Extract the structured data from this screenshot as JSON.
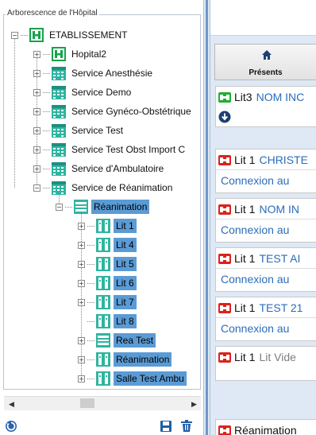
{
  "tree_panel": {
    "legend": "Arborescence de l'Hôpital",
    "nodes": [
      {
        "label": "ETABLISSEMENT",
        "icon": "hospital-icon",
        "level": 0,
        "expander": "−"
      },
      {
        "label": "Hopital2",
        "icon": "hospital-icon",
        "level": 1,
        "expander": "+"
      },
      {
        "label": "Service Anesthésie",
        "icon": "service-icon",
        "level": 1,
        "expander": "+"
      },
      {
        "label": "Service Demo",
        "icon": "service-icon",
        "level": 1,
        "expander": "+"
      },
      {
        "label": "Service Gynéco-Obstétrique",
        "icon": "service-icon",
        "level": 1,
        "expander": "+"
      },
      {
        "label": "Service Test",
        "icon": "service-icon",
        "level": 1,
        "expander": "+"
      },
      {
        "label": "Service Test Obst Import C",
        "icon": "service-icon",
        "level": 1,
        "expander": "+"
      },
      {
        "label": "Service d'Ambulatoire",
        "icon": "service-icon",
        "level": 1,
        "expander": "+"
      },
      {
        "label": "Service de Réanimation",
        "icon": "service-icon",
        "level": 1,
        "expander": "−"
      },
      {
        "label": "Réanimation",
        "icon": "unit-icon",
        "level": 2,
        "expander": "−",
        "selected": true
      },
      {
        "label": "Lit 1",
        "icon": "bed-icon",
        "level": 3,
        "expander": "+",
        "selected": true
      },
      {
        "label": "Lit 4",
        "icon": "bed-icon",
        "level": 3,
        "expander": "+",
        "selected": true
      },
      {
        "label": "Lit 5",
        "icon": "bed-icon",
        "level": 3,
        "expander": "+",
        "selected": true
      },
      {
        "label": "Lit 6",
        "icon": "bed-icon",
        "level": 3,
        "expander": "+",
        "selected": true
      },
      {
        "label": "Lit 7",
        "icon": "bed-icon",
        "level": 3,
        "expander": "+",
        "selected": true
      },
      {
        "label": "Lit 8",
        "icon": "bed-icon",
        "level": 3,
        "expander": "",
        "selected": true
      },
      {
        "label": "Rea Test",
        "icon": "unit-icon",
        "level": 3,
        "expander": "+",
        "selected": true
      },
      {
        "label": "Réanimation",
        "icon": "bed-icon",
        "level": 3,
        "expander": "+",
        "selected": true
      },
      {
        "label": "Salle Test Ambu",
        "icon": "bed-icon",
        "level": 3,
        "expander": "+",
        "selected": true
      }
    ],
    "scroll_left": "◀",
    "scroll_right": "▶"
  },
  "bottom_bar": {
    "refresh_icon": "refresh-icon",
    "save_icon": "save-icon",
    "delete_icon": "trash-icon"
  },
  "right_panel": {
    "tab": {
      "label": "Présents",
      "icon": "home-icon"
    },
    "cards": [
      {
        "bed": "Lit3",
        "patient": "NOM INC",
        "status": "green",
        "second_line": "",
        "has_action": true
      },
      {
        "bed": "Lit 1",
        "patient": "CHRISTE",
        "status": "red",
        "second_line": "Connexion au"
      },
      {
        "bed": "Lit 1",
        "patient": "NOM IN",
        "status": "red",
        "second_line": "Connexion au"
      },
      {
        "bed": "Lit 1",
        "patient": "TEST AI",
        "status": "red",
        "second_line": "Connexion au"
      },
      {
        "bed": "Lit 1",
        "patient": "TEST 21",
        "status": "red",
        "second_line": "Connexion au"
      },
      {
        "bed": "Lit 1",
        "patient": "Lit Vide",
        "status": "red",
        "second_line": "",
        "grey": true
      },
      {
        "bed": "Réanimation",
        "patient": "",
        "status": "red",
        "second_line": "",
        "cut": true
      }
    ]
  },
  "colors": {
    "selection": "#5b9bd5",
    "link": "#2a6db8",
    "green_status": "#1fae2f",
    "red_status": "#d9241c",
    "panel_bg": "#dfe9f5"
  }
}
